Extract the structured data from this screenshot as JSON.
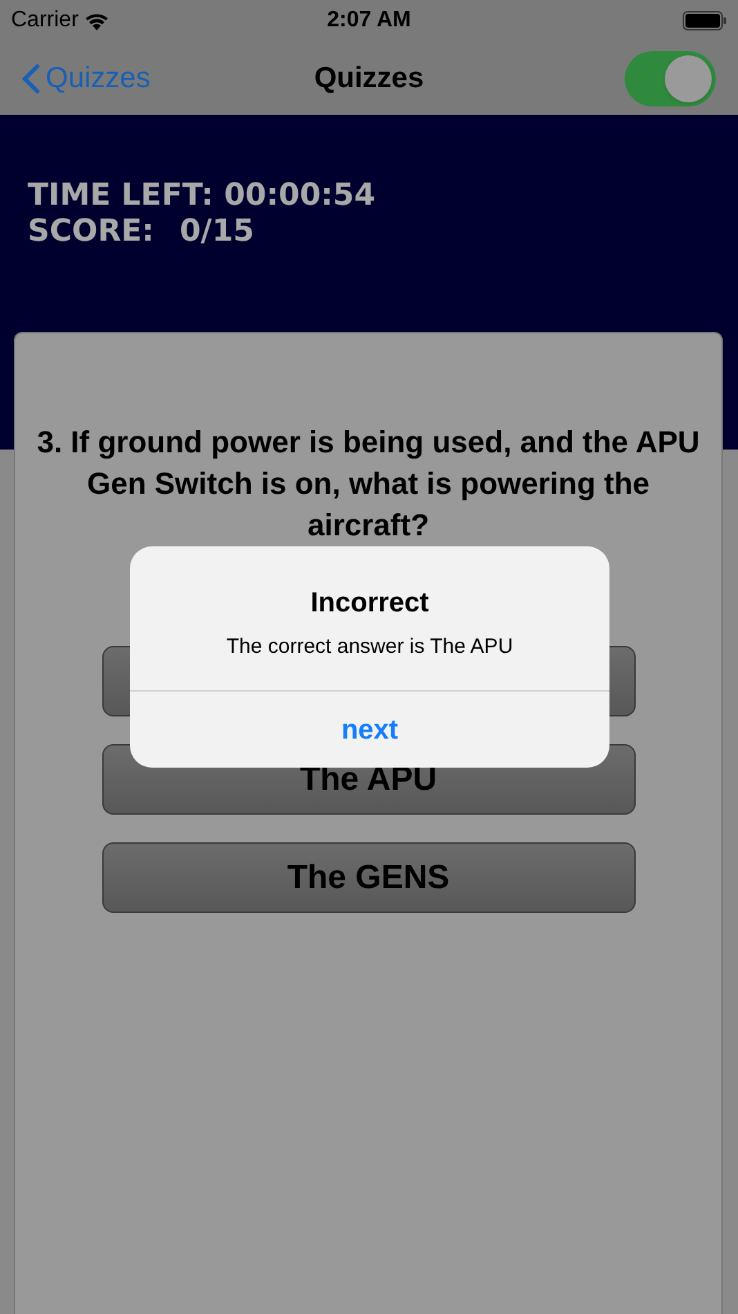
{
  "status_bar": {
    "carrier": "Carrier",
    "time": "2:07 AM"
  },
  "nav": {
    "back": "Quizzes",
    "title": "Quizzes",
    "toggle_on": true
  },
  "header": {
    "time_left": "TIME LEFT: 00:00:54",
    "score_label": "SCORE:",
    "score": "0/15"
  },
  "question": "3. If ground power is being used, and the APU Gen Switch is on, what is powering the aircraft?",
  "answers": [
    {
      "kind": "covered"
    },
    {
      "kind": "labeled",
      "label": "The APU"
    },
    {
      "kind": "labeled",
      "label": "The GENS"
    }
  ],
  "alert": {
    "title": "Incorrect",
    "message": "The correct answer is The APU",
    "button": "next"
  }
}
